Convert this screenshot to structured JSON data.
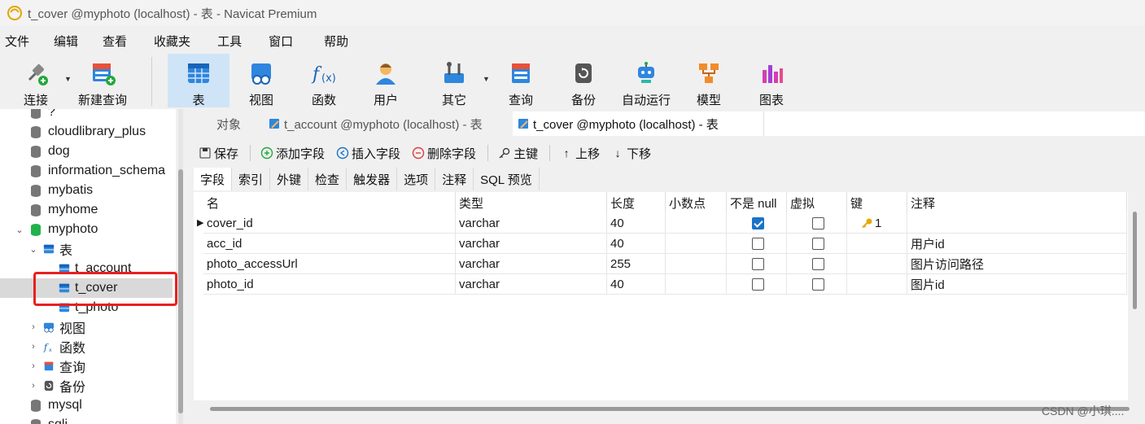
{
  "window": {
    "title": "t_cover @myphoto (localhost) - 表 - Navicat Premium"
  },
  "menu": [
    "文件",
    "编辑",
    "查看",
    "收藏夹",
    "工具",
    "窗口",
    "帮助"
  ],
  "toolbar": {
    "connect": "连接",
    "new_query": "新建查询",
    "table": "表",
    "view": "视图",
    "function": "函数",
    "user": "用户",
    "other": "其它",
    "query": "查询",
    "backup": "备份",
    "automation": "自动运行",
    "model": "模型",
    "chart": "图表"
  },
  "sidebar": {
    "items": [
      {
        "label": "?"
      },
      {
        "label": "cloudlibrary_plus"
      },
      {
        "label": "dog"
      },
      {
        "label": "information_schema"
      },
      {
        "label": "mybatis"
      },
      {
        "label": "myhome"
      },
      {
        "label": "myphoto"
      },
      {
        "label": "表"
      },
      {
        "label": "t_account"
      },
      {
        "label": "t_cover"
      },
      {
        "label": "t_photo"
      },
      {
        "label": "视图"
      },
      {
        "label": "函数"
      },
      {
        "label": "查询"
      },
      {
        "label": "备份"
      },
      {
        "label": "mysql"
      },
      {
        "label": "sqli"
      }
    ]
  },
  "tabs": {
    "objects": "对象",
    "tab1": "t_account @myphoto (localhost) - 表",
    "tab2": "t_cover @myphoto (localhost) - 表"
  },
  "editor_toolbar": {
    "save": "保存",
    "add_field": "添加字段",
    "insert_field": "插入字段",
    "delete_field": "删除字段",
    "primary_key": "主键",
    "move_up": "上移",
    "move_down": "下移"
  },
  "prop_tabs": [
    "字段",
    "索引",
    "外键",
    "检查",
    "触发器",
    "选项",
    "注释",
    "SQL 预览"
  ],
  "grid": {
    "columns": [
      "名",
      "类型",
      "长度",
      "小数点",
      "不是 null",
      "虚拟",
      "键",
      "注释"
    ],
    "rows": [
      {
        "name": "cover_id",
        "type": "varchar",
        "length": "40",
        "decimals": "",
        "not_null": true,
        "virtual": false,
        "key": "1",
        "comment": ""
      },
      {
        "name": "acc_id",
        "type": "varchar",
        "length": "40",
        "decimals": "",
        "not_null": false,
        "virtual": false,
        "key": "",
        "comment": "用户id"
      },
      {
        "name": "photo_accessUrl",
        "type": "varchar",
        "length": "255",
        "decimals": "",
        "not_null": false,
        "virtual": false,
        "key": "",
        "comment": "图片访问路径"
      },
      {
        "name": "photo_id",
        "type": "varchar",
        "length": "40",
        "decimals": "",
        "not_null": false,
        "virtual": false,
        "key": "",
        "comment": "图片id"
      }
    ]
  },
  "watermark": "CSDN @小琪....",
  "colors": {
    "accent": "#1a73c8",
    "selected_tab": "#cfe4f7",
    "highlight": "#e82020",
    "db_active": "#22b24c"
  }
}
